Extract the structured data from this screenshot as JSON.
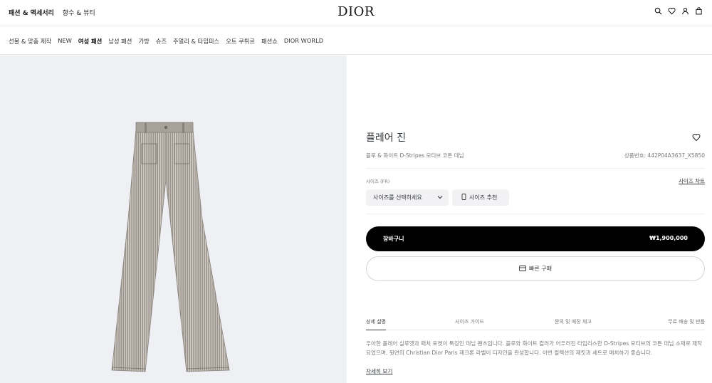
{
  "header": {
    "nav_left": [
      "패션 & 액세서리",
      "향수 & 뷰티"
    ],
    "logo": "DIOR",
    "icons": [
      "search-icon",
      "heart-icon",
      "user-icon",
      "bag-icon"
    ]
  },
  "category_nav": {
    "items": [
      "선물 & 맞춤 제작",
      "NEW",
      "여성 패션",
      "남성 패션",
      "가방",
      "슈즈",
      "주얼리 & 타임피스",
      "오트 쿠튀르",
      "패션쇼",
      "DIOR WORLD"
    ],
    "active": "여성 패션"
  },
  "product": {
    "title": "플레어 진",
    "description": "블루 & 화이트 D-Stripes 모티브 코튼 데님",
    "code": "상품번호: 442P04A3637_X5850",
    "size_label": "사이즈 (FR)",
    "size_chart": "사이즈 차트",
    "size_select_placeholder": "사이즈를 선택하세요",
    "size_recommend": "사이즈 추천",
    "cart_label": "장바구니",
    "price": "₩1,900,000",
    "quick_buy": "빠른 구매"
  },
  "tabs": [
    "상세 설명",
    "사이즈 가이드",
    "문의 및 매장 재고",
    "무료 배송 및 반품"
  ],
  "active_tab": "상세 설명",
  "details": {
    "text": "우아한 플레어 실루엣과 패치 포켓이 특징인 데님 팬츠입니다. 블루와 화이트 컬러가 어우러진 타임리스한 D-Stripes 모티브의 코튼 데님 소재로 제작되었으며, 뒷면의 Christian Dior Paris 재크론 라벨이 디자인을 완성합니다. 이번 컬렉션의 재킷과 세트로 매치하기 좋습니다.",
    "more": "자세히 보기"
  },
  "colors": {
    "brand_black": "#000000",
    "image_bg": "#eff0f4",
    "button_bg": "#f2f2f4",
    "text": "#33383c",
    "muted": "#77787b"
  }
}
